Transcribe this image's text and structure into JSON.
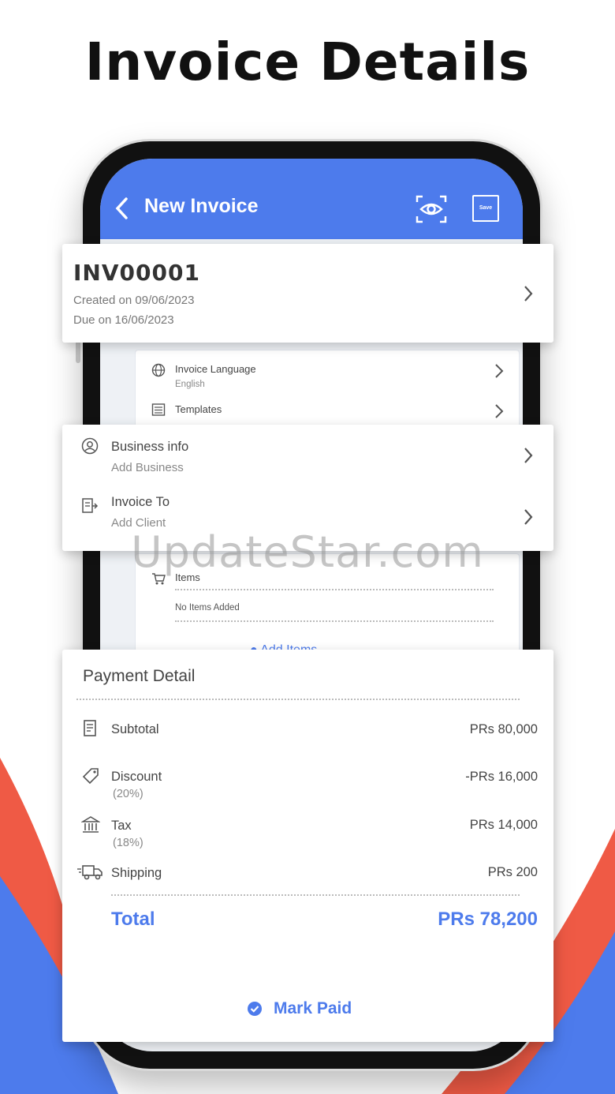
{
  "headline": "Invoice Details",
  "colors": {
    "primary": "#4d7bec",
    "accent_red": "#ef5a45",
    "text": "#444444"
  },
  "appbar": {
    "title": "New Invoice",
    "back_icon": "chevron-left-icon",
    "preview_icon": "eye-icon",
    "save_label": "Save"
  },
  "invoice_card": {
    "number": "INV00001",
    "created": "Created on 09/06/2023",
    "due": "Due on 16/06/2023"
  },
  "settings": {
    "language_label": "Invoice Language",
    "language_value": "English",
    "templates_label": "Templates"
  },
  "parties": {
    "business_label": "Business info",
    "business_sub": "Add Business",
    "client_label": "Invoice To",
    "client_sub": "Add Client"
  },
  "items": {
    "label": "Items",
    "empty": "No Items Added",
    "add_label": "Add Items"
  },
  "payment": {
    "title": "Payment Detail",
    "subtotal_label": "Subtotal",
    "subtotal_value": "PRs 80,000",
    "discount_label": "Discount",
    "discount_pct": "(20%)",
    "discount_value": "-PRs 16,000",
    "tax_label": "Tax",
    "tax_pct": "(18%)",
    "tax_value": "PRs 14,000",
    "shipping_label": "Shipping",
    "shipping_value": "PRs 200",
    "total_label": "Total",
    "total_value": "PRs 78,200",
    "mark_paid_label": "Mark Paid"
  },
  "watermark": "UpdateStar.com"
}
